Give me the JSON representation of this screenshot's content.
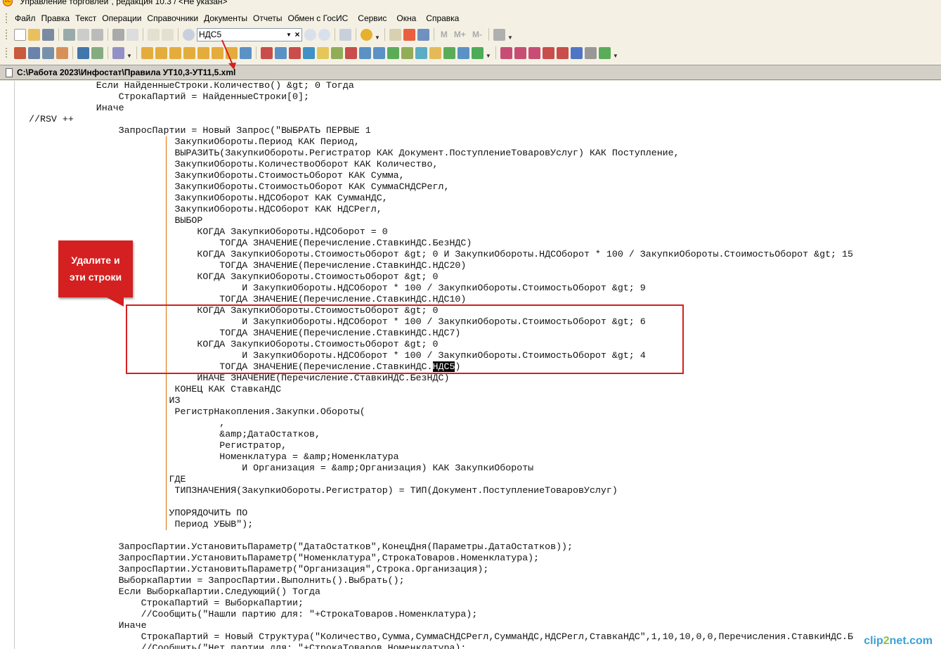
{
  "window": {
    "title": "\"Управление торговлей\", редакция 10.3 / <Не указан>"
  },
  "menu": [
    "Файл",
    "Правка",
    "Текст",
    "Операции",
    "Справочники",
    "Документы",
    "Отчеты",
    "Обмен с ГосИС",
    "Сервис",
    "Окна",
    "Справка"
  ],
  "toolbar": {
    "search_value": "НДС5",
    "memory_buttons": [
      "M",
      "M+",
      "M-"
    ]
  },
  "document": {
    "path": "C:\\Работа 2023\\Инфостат\\Правила УТ10,3-УТ11,5.xml"
  },
  "callout": {
    "line1": "Удалите и",
    "line2": "эти строки"
  },
  "watermark": "clip2net.com",
  "colors": {
    "annotation": "#d42020",
    "pipe": "#e07000"
  },
  "code_lines": [
    {
      "t": "            Если НайденныеСтроки.Количество() &gt; 0 Тогда"
    },
    {
      "t": "                СтрокаПартий = НайденныеСтроки[0];"
    },
    {
      "t": "            Иначе"
    },
    {
      "t": "//RSV ++"
    },
    {
      "t": "                ЗапросПартии = Новый Запрос(\"ВЫБРАТЬ ПЕРВЫЕ 1"
    },
    {
      "t": "                        | ЗакупкиОбороты.Период КАК Период,"
    },
    {
      "t": "                        | ВЫРАЗИТЬ(ЗакупкиОбороты.Регистратор КАК Документ.ПоступлениеТоваровУслуг) КАК Поступление,"
    },
    {
      "t": "                        | ЗакупкиОбороты.КоличествоОборот КАК Количество,"
    },
    {
      "t": "                        | ЗакупкиОбороты.СтоимостьОборот КАК Сумма,"
    },
    {
      "t": "                        | ЗакупкиОбороты.СтоимостьОборот КАК СуммаСНДСРегл,"
    },
    {
      "t": "                        | ЗакупкиОбороты.НДСОборот КАК СуммаНДС,"
    },
    {
      "t": "                        | ЗакупкиОбороты.НДСОборот КАК НДСРегл,"
    },
    {
      "t": "                        | ВЫБОР"
    },
    {
      "t": "                        |     КОГДА ЗакупкиОбороты.НДСОборот = 0"
    },
    {
      "t": "                        |         ТОГДА ЗНАЧЕНИЕ(Перечисление.СтавкиНДС.БезНДС)"
    },
    {
      "t": "                        |     КОГДА ЗакупкиОбороты.СтоимостьОборот &gt; 0 И ЗакупкиОбороты.НДСОборот * 100 / ЗакупкиОбороты.СтоимостьОборот &gt; 15"
    },
    {
      "t": "                        |         ТОГДА ЗНАЧЕНИЕ(Перечисление.СтавкиНДС.НДС20)"
    },
    {
      "t": "                        |     КОГДА ЗакупкиОбороты.СтоимостьОборот &gt; 0"
    },
    {
      "t": "                        |             И ЗакупкиОбороты.НДСОборот * 100 / ЗакупкиОбороты.СтоимостьОборот &gt; 9"
    },
    {
      "t": "                        |         ТОГДА ЗНАЧЕНИЕ(Перечисление.СтавкиНДС.НДС10)"
    },
    {
      "t": "                        |     КОГДА ЗакупкиОбороты.СтоимостьОборот &gt; 0"
    },
    {
      "t": "                        |             И ЗакупкиОбороты.НДСОборот * 100 / ЗакупкиОбороты.СтоимостьОборот &gt; 6"
    },
    {
      "t": "                        |         ТОГДА ЗНАЧЕНИЕ(Перечисление.СтавкиНДС.НДС7)"
    },
    {
      "t": "                        |     КОГДА ЗакупкиОбороты.СтоимостьОборот &gt; 0"
    },
    {
      "t": "                        |             И ЗакупкиОбороты.НДСОборот * 100 / ЗакупкиОбороты.СтоимостьОборот &gt; 4"
    },
    {
      "t": "                        |         ТОГДА ЗНАЧЕНИЕ(Перечисление.СтавкиНДС.",
      "sel": "НДС5",
      "after": ")"
    },
    {
      "t": "                        |     ИНАЧЕ ЗНАЧЕНИЕ(Перечисление.СтавкиНДС.БезНДС)"
    },
    {
      "t": "                        | КОНЕЦ КАК СтавкаНДС"
    },
    {
      "t": "                        |ИЗ"
    },
    {
      "t": "                        | РегистрНакопления.Закупки.Обороты("
    },
    {
      "t": "                        |         ,"
    },
    {
      "t": "                        |         &amp;ДатаОстатков,"
    },
    {
      "t": "                        |         Регистратор,"
    },
    {
      "t": "                        |         Номенклатура = &amp;Номенклатура"
    },
    {
      "t": "                        |             И Организация = &amp;Организация) КАК ЗакупкиОбороты"
    },
    {
      "t": "                        |ГДЕ"
    },
    {
      "t": "                        | ТИПЗНАЧЕНИЯ(ЗакупкиОбороты.Регистратор) = ТИП(Документ.ПоступлениеТоваровУслуг)"
    },
    {
      "t": "                        |"
    },
    {
      "t": "                        |УПОРЯДОЧИТЬ ПО"
    },
    {
      "t": "                        | Период УБЫВ\");"
    },
    {
      "t": ""
    },
    {
      "t": "                ЗапросПартии.УстановитьПараметр(\"ДатаОстатков\",КонецДня(Параметры.ДатаОстатков));"
    },
    {
      "t": "                ЗапросПартии.УстановитьПараметр(\"Номенклатура\",СтрокаТоваров.Номенклатура);"
    },
    {
      "t": "                ЗапросПартии.УстановитьПараметр(\"Организация\",Строка.Организация);"
    },
    {
      "t": "                ВыборкаПартии = ЗапросПартии.Выполнить().Выбрать();"
    },
    {
      "t": "                Если ВыборкаПартии.Следующий() Тогда"
    },
    {
      "t": "                    СтрокаПартий = ВыборкаПартии;"
    },
    {
      "t": "                    //Сообщить(\"Нашли партию для: \"+СтрокаТоваров.Номенклатура);"
    },
    {
      "t": "                Иначе"
    },
    {
      "t": "                    СтрокаПартий = Новый Структура(\"Количество,Сумма,СуммаСНДСРегл,СуммаНДС,НДСРегл,СтавкаНДС\",1,10,10,0,0,Перечисления.СтавкиНДС.Б"
    },
    {
      "t": "                    //Сообщить(\"Нет партии для: \"+СтрокаТоваров.Номенклатура);"
    }
  ]
}
